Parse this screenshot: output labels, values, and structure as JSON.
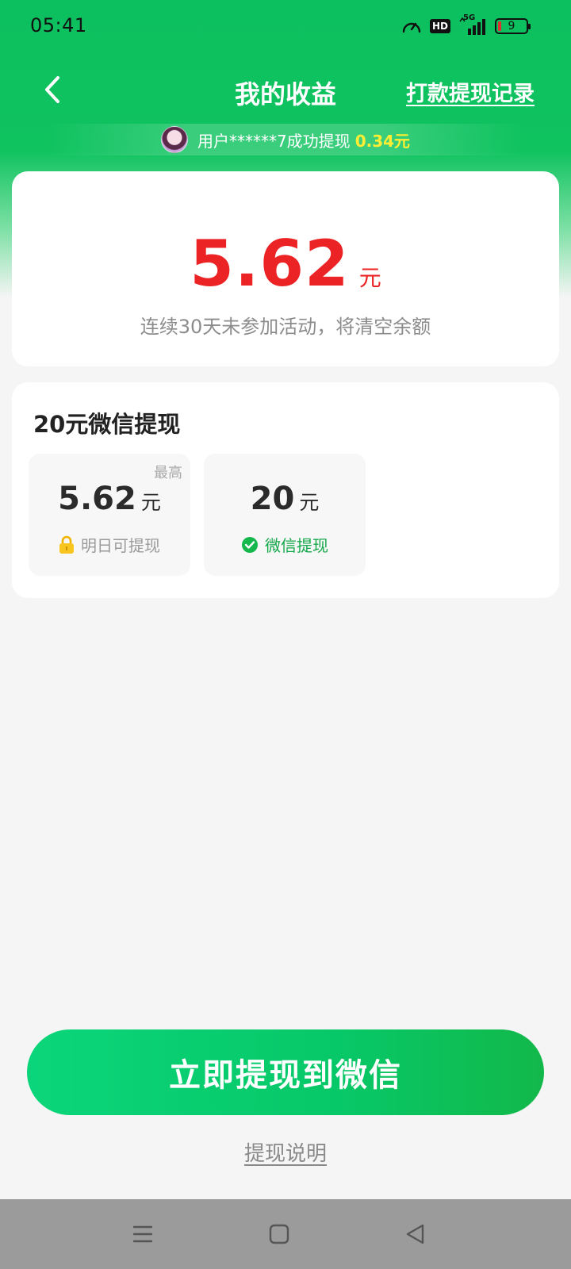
{
  "status_bar": {
    "time": "05:41",
    "network_label": "5G",
    "hd_label": "HD",
    "battery_level": "9",
    "icons": [
      "speed-gauge-icon",
      "hd-icon",
      "signal-5g-icon",
      "battery-icon"
    ]
  },
  "header": {
    "back_icon": "chevron-left-icon",
    "title": "我的收益",
    "records_link": "打款提现记录"
  },
  "ticker": {
    "text": "用户******7成功提现",
    "amount": "0.34元"
  },
  "balance": {
    "amount": "5.62",
    "unit": "元",
    "note": "连续30天未参加活动，将清空余额"
  },
  "withdraw": {
    "title": "20元微信提现",
    "options": [
      {
        "tag": "最高",
        "amount": "5.62",
        "unit": "元",
        "status": "明日可提现",
        "status_icon": "lock-icon"
      },
      {
        "tag": "",
        "amount": "20",
        "unit": "元",
        "status": "微信提现",
        "status_icon": "wechat-check-icon"
      }
    ]
  },
  "actions": {
    "withdraw_button": "立即提现到微信",
    "help_link": "提现说明"
  },
  "nav_bar": {
    "icons": [
      "menu-icon",
      "home-icon",
      "back-triangle-icon"
    ]
  },
  "colors": {
    "brand_green": "#0fc35f",
    "amount_red": "#ec2325",
    "ticker_highlight": "#ffee33",
    "wechat_green": "#14a84a"
  }
}
